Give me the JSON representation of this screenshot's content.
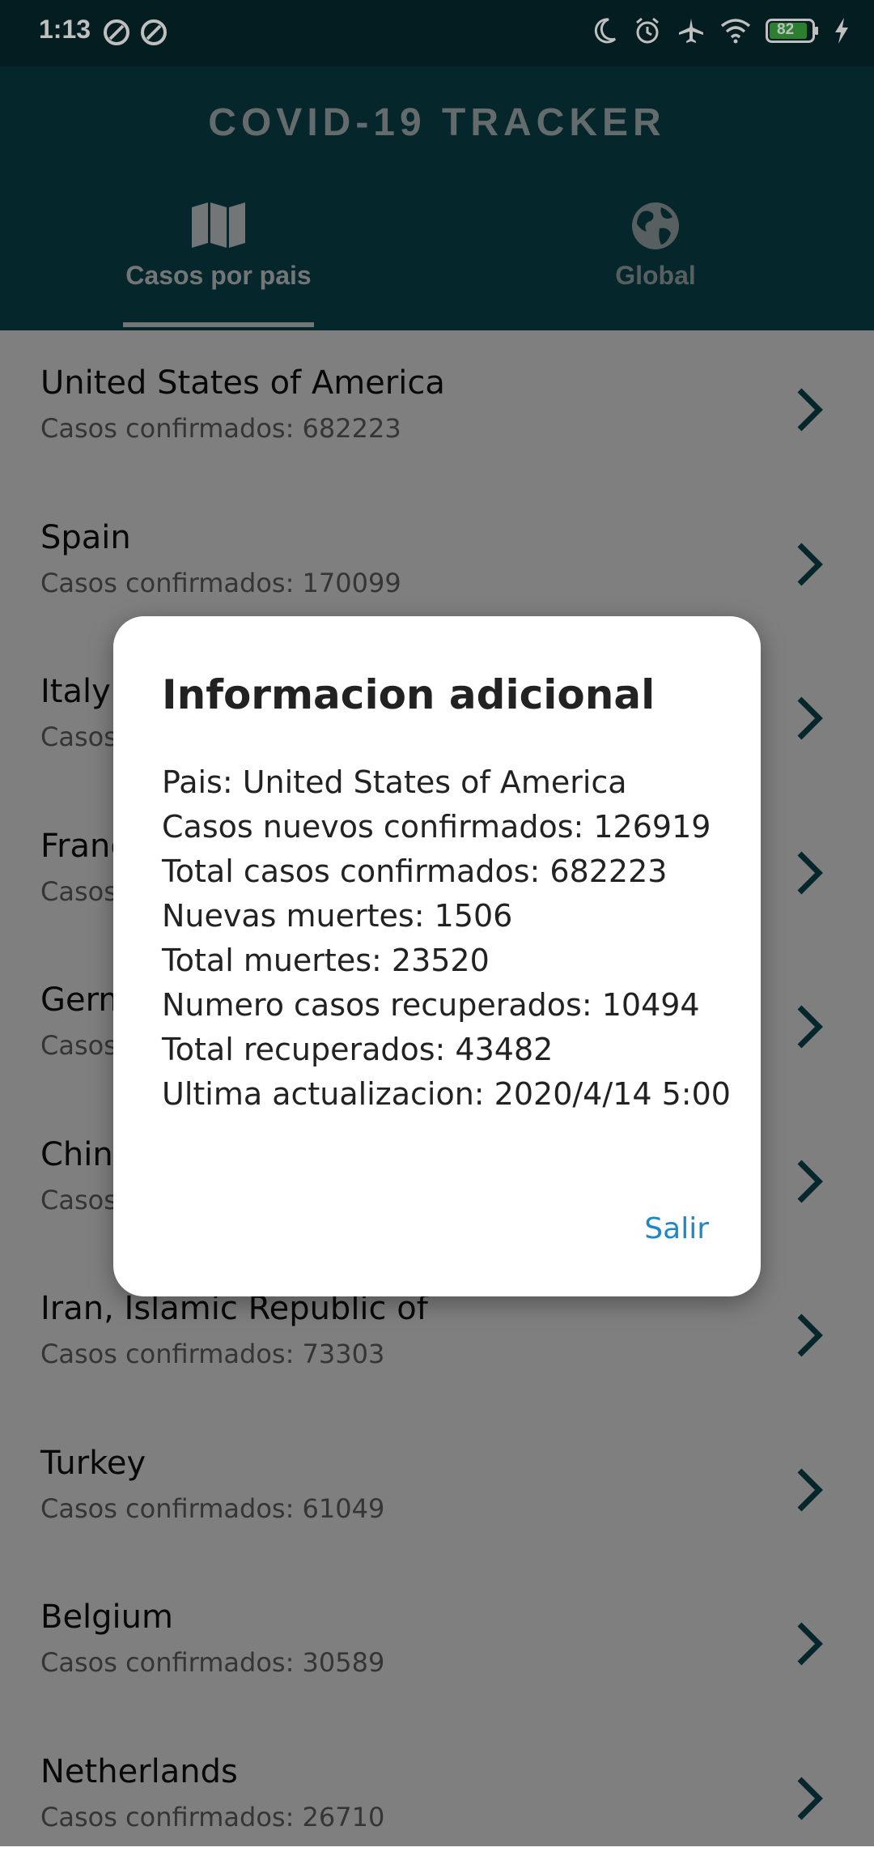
{
  "status_bar": {
    "time": "1:13",
    "battery": "82"
  },
  "app_bar": {
    "title": "COVID-19 TRACKER",
    "tabs": [
      {
        "label": "Casos por pais",
        "icon": "map-icon",
        "selected": true
      },
      {
        "label": "Global",
        "icon": "globe-icon",
        "selected": false
      }
    ]
  },
  "countries": [
    {
      "name": "United States of America",
      "cases": "Casos confirmados: 682223"
    },
    {
      "name": "Spain",
      "cases": "Casos confirmados: 170099"
    },
    {
      "name": "Italy",
      "cases": "Casos"
    },
    {
      "name": "Franc",
      "cases": "Casos"
    },
    {
      "name": "Germ",
      "cases": "Casos"
    },
    {
      "name": "China",
      "cases": "Casos"
    },
    {
      "name": "Iran, Islamic Republic of",
      "cases": "Casos confirmados: 73303"
    },
    {
      "name": "Turkey",
      "cases": "Casos confirmados: 61049"
    },
    {
      "name": "Belgium",
      "cases": "Casos confirmados: 30589"
    },
    {
      "name": "Netherlands",
      "cases": "Casos confirmados: 26710"
    }
  ],
  "dialog": {
    "title": "Informacion adicional",
    "lines": [
      "Pais: United States of America",
      "Casos nuevos confirmados: 126919",
      "Total casos confirmados: 682223",
      "Nuevas muertes: 1506",
      "Total muertes: 23520",
      "Numero casos recuperados: 10494",
      "Total recuperados: 43482",
      "Ultima actualizacion: 2020/4/14 5:00"
    ],
    "button": "Salir"
  },
  "colors": {
    "app_bar": "#0a4c54",
    "status_bar": "#06272c",
    "chevron": "#0a4c54",
    "dialog_button": "#1e88c7"
  }
}
